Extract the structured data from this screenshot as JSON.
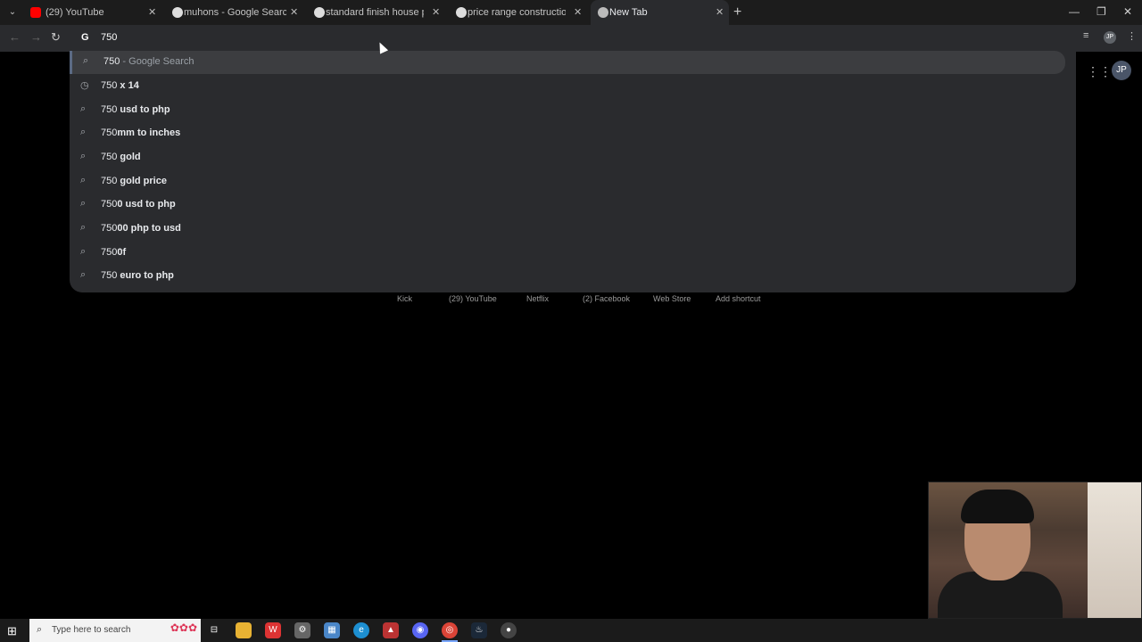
{
  "tabs": [
    {
      "title": "(29) YouTube",
      "icon": "youtube-icon",
      "color": "#ff0000"
    },
    {
      "title": "muhons - Google Search",
      "icon": "google-icon",
      "color": "#dddddd"
    },
    {
      "title": "standard finish house philippin",
      "icon": "google-icon",
      "color": "#dddddd"
    },
    {
      "title": "price range construction philipp",
      "icon": "google-icon",
      "color": "#dddddd"
    },
    {
      "title": "New Tab",
      "icon": "chrome-icon",
      "color": "#bbbbbb"
    }
  ],
  "omnibox": {
    "engine_glyph": "G",
    "text": "750"
  },
  "suggestions": [
    {
      "icon": "search-icon",
      "prefix": "750",
      "rest": "",
      "desc": " - Google Search"
    },
    {
      "icon": "history-icon",
      "prefix": "750",
      "rest": " x 14",
      "desc": ""
    },
    {
      "icon": "search-icon",
      "prefix": "750",
      "rest": " usd to php",
      "desc": ""
    },
    {
      "icon": "search-icon",
      "prefix": "750",
      "rest": "mm to inches",
      "desc": ""
    },
    {
      "icon": "search-icon",
      "prefix": "750",
      "rest": " gold",
      "desc": ""
    },
    {
      "icon": "search-icon",
      "prefix": "750",
      "rest": " gold price",
      "desc": ""
    },
    {
      "icon": "search-icon",
      "prefix": "750",
      "rest": "0 usd to php",
      "desc": ""
    },
    {
      "icon": "search-icon",
      "prefix": "750",
      "rest": "00 php to usd",
      "desc": ""
    },
    {
      "icon": "search-icon",
      "prefix": "750",
      "rest": "0f",
      "desc": ""
    },
    {
      "icon": "search-icon",
      "prefix": "750",
      "rest": " euro to php",
      "desc": ""
    }
  ],
  "profile": {
    "initials": "JP"
  },
  "shortcuts": [
    "Kick",
    "(29) YouTube",
    "Netflix",
    "(2) Facebook",
    "Web Store",
    "Add shortcut"
  ],
  "taskbar": {
    "search_placeholder": "Type here to search"
  }
}
